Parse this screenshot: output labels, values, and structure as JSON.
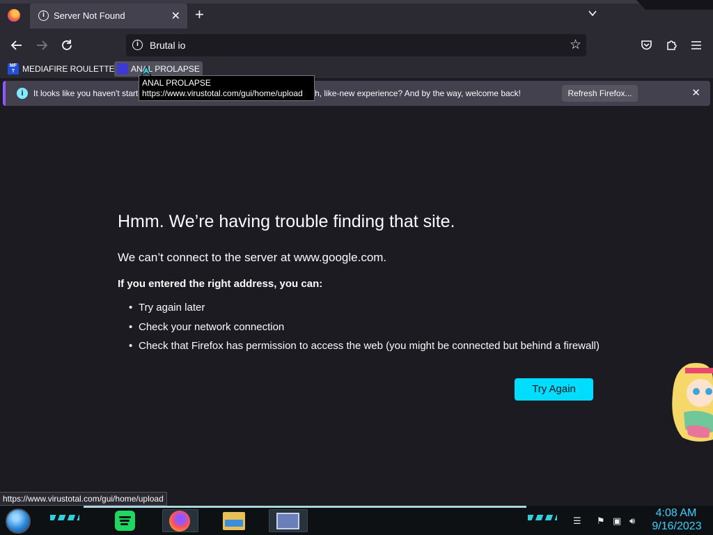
{
  "tabs": [
    {
      "title": "Server Not Found",
      "icon": "info-icon"
    }
  ],
  "urlbar": {
    "value": "Brutal io"
  },
  "bookmarks": [
    {
      "label": "MEDIAFIRE ROULETTER",
      "favicon": "MF\nT"
    },
    {
      "label": "ANAL PROLAPSE"
    }
  ],
  "tooltip": {
    "title": "ANAL PROLAPSE",
    "url": "https://www.virustotal.com/gui/home/upload"
  },
  "notification": {
    "message_start": "It looks like you haven't starte",
    "message_end": "or a fresh, like-new experience? And by the way, welcome back!",
    "button": "Refresh Firefox..."
  },
  "error": {
    "title": "Hmm. We’re having trouble finding that site.",
    "subtitle": "We can’t connect to the server at www.google.com.",
    "lead": "If you entered the right address, you can:",
    "suggestions": [
      "Try again later",
      "Check your network connection",
      "Check that Firefox has permission to access the web (you might be connected but behind a firewall)"
    ],
    "button": "Try Again"
  },
  "status_url": "https://www.virustotal.com/gui/home/upload",
  "taskbar": {
    "time": "4:08 AM",
    "date": "9/16/2023"
  },
  "colors": {
    "accent": "#00ddff",
    "clock": "#3ad1ff",
    "toolbar": "#2b2a33",
    "page": "#1c1b22"
  }
}
